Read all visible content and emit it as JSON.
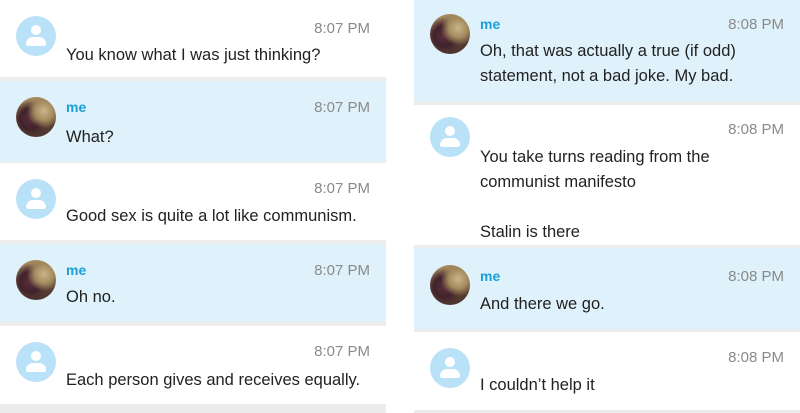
{
  "left_column": {
    "messages": [
      {
        "sender": "",
        "time": "8:07 PM",
        "text": "You know what I was just thinking?"
      },
      {
        "sender": "me",
        "time": "8:07 PM",
        "text": "What?"
      },
      {
        "sender": "",
        "time": "8:07 PM",
        "text": "Good sex is quite a lot like communism."
      },
      {
        "sender": "me",
        "time": "8:07 PM",
        "text": "Oh no."
      },
      {
        "sender": "",
        "time": "8:07 PM",
        "text": "Each person gives and receives equally."
      }
    ]
  },
  "right_column": {
    "messages": [
      {
        "sender": "me",
        "time": "8:08 PM",
        "text": "Oh, that was actually a true (if odd)\nstatement, not a bad joke. My bad."
      },
      {
        "sender": "",
        "time": "8:08 PM",
        "text": "You take turns reading from the\ncommunist manifesto\n\nStalin is there"
      },
      {
        "sender": "me",
        "time": "8:08 PM",
        "text": "And there we go."
      },
      {
        "sender": "",
        "time": "8:08 PM",
        "text": "I couldn’t help it"
      }
    ]
  },
  "colors": {
    "accent": "#1aa0d8",
    "own_message_bg": "#dff1fa",
    "other_message_bg": "#ffffff",
    "default_avatar": "#b9e1f7"
  }
}
